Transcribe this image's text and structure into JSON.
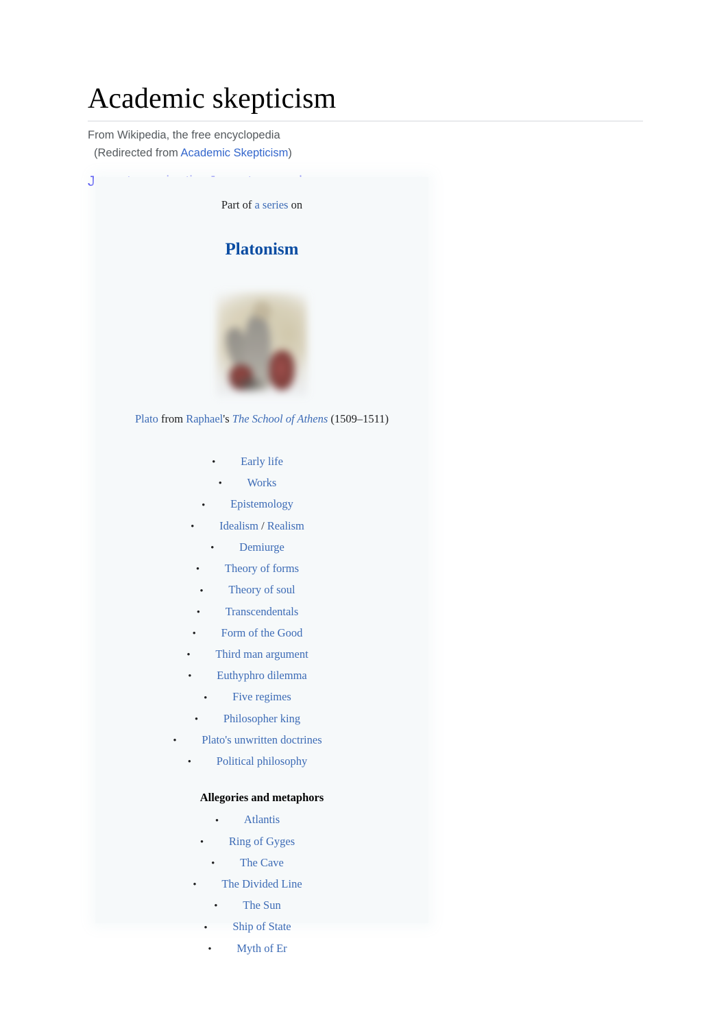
{
  "page": {
    "title": "Academic skepticism",
    "tagline": "From Wikipedia, the free encyclopedia",
    "redirect_prefix": "(Redirected from ",
    "redirect_link": "Academic Skepticism",
    "redirect_suffix": ")",
    "jump_to_navigation": "Jump to navigation",
    "jump_to_search": "Jump to search"
  },
  "infobox": {
    "above_prefix": "Part of ",
    "above_link": "a series",
    "above_suffix": " on",
    "title": "Platonism",
    "image_alt": "Plato from The School of Athens",
    "caption": {
      "subject": "Plato",
      "from": " from ",
      "artist": "Raphael",
      "possessive": "'s ",
      "work": "The School of Athens",
      "dates": " (1509–1511)"
    },
    "bullet": "•",
    "items": [
      {
        "label": "Early life"
      },
      {
        "label": "Works"
      },
      {
        "label": "Epistemology"
      },
      {
        "label": "Idealism",
        "separator": " / ",
        "label2": "Realism"
      },
      {
        "label": "Demiurge"
      },
      {
        "label": "Theory of forms"
      },
      {
        "label": "Theory of soul"
      },
      {
        "label": "Transcendentals"
      },
      {
        "label": "Form of the Good"
      },
      {
        "label": "Third man argument"
      },
      {
        "label": "Euthyphro dilemma"
      },
      {
        "label": "Five regimes"
      },
      {
        "label": "Philosopher king"
      },
      {
        "label": "Plato's unwritten doctrines"
      },
      {
        "label": "Political philosophy"
      }
    ],
    "section_heading": "Allegories and metaphors",
    "allegory_items": [
      {
        "label": "Atlantis"
      },
      {
        "label": "Ring of Gyges"
      },
      {
        "label": "The Cave"
      },
      {
        "label": "The Divided Line"
      },
      {
        "label": "The Sun"
      },
      {
        "label": "Ship of State"
      },
      {
        "label": "Myth of Er"
      }
    ]
  },
  "colors": {
    "link_blue": "#3b6ab5",
    "title_blue": "#0b4da2",
    "jump_link_blue": "#0000ee",
    "redirect_link_blue": "#3366cc",
    "infobox_background": "#f6f9fa",
    "text": "#202122"
  }
}
